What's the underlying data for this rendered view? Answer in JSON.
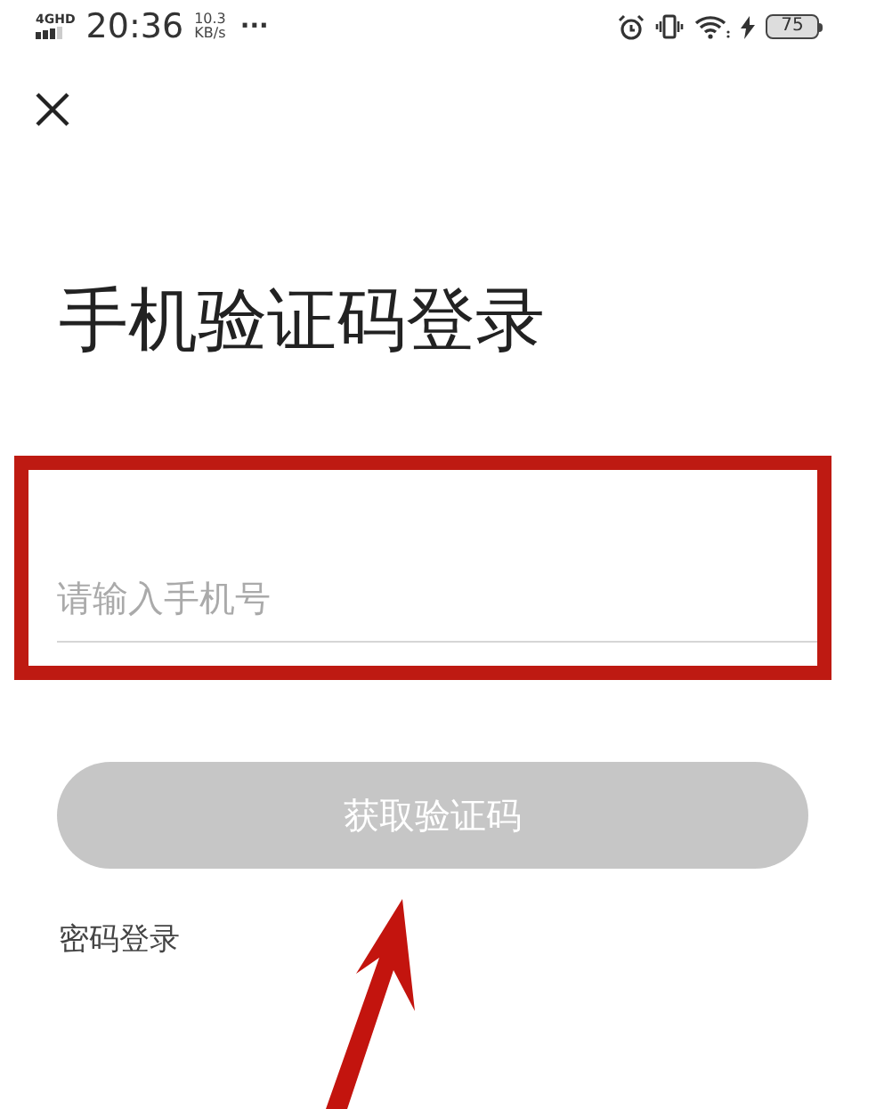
{
  "status_bar": {
    "network": "4GHD",
    "time": "20:36",
    "speed_value": "10.3",
    "speed_unit": "KB/s",
    "more": "···",
    "battery": "75"
  },
  "title": "手机验证码登录",
  "phone_field": {
    "placeholder": "请输入手机号"
  },
  "get_code_button": {
    "label": "获取验证码",
    "disabled": true
  },
  "password_login_link": "密码登录"
}
